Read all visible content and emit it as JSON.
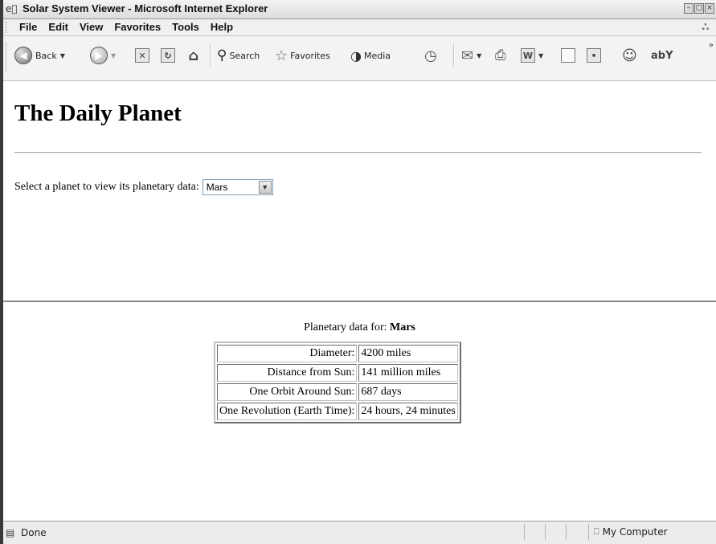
{
  "window": {
    "title": "Solar System Viewer - Microsoft Internet Explorer",
    "icon": "ie-icon"
  },
  "menu": {
    "items": [
      "File",
      "Edit",
      "View",
      "Favorites",
      "Tools",
      "Help"
    ]
  },
  "toolbar": {
    "back_label": "Back",
    "search_label": "Search",
    "favorites_label": "Favorites",
    "media_label": "Media",
    "extra_label": "abY"
  },
  "page": {
    "title": "The Daily Planet",
    "select_label": "Select a planet to view its planetary data:",
    "selected_planet": "Mars",
    "data_heading_prefix": "Planetary data for:",
    "data_heading_planet": "Mars",
    "rows": [
      {
        "label": "Diameter:",
        "value": "4200 miles"
      },
      {
        "label": "Distance from Sun:",
        "value": "141 million miles"
      },
      {
        "label": "One Orbit Around Sun:",
        "value": "687 days"
      },
      {
        "label": "One Revolution (Earth Time):",
        "value": "24 hours, 24 minutes"
      }
    ]
  },
  "status": {
    "text": "Done",
    "zone": "My Computer"
  }
}
